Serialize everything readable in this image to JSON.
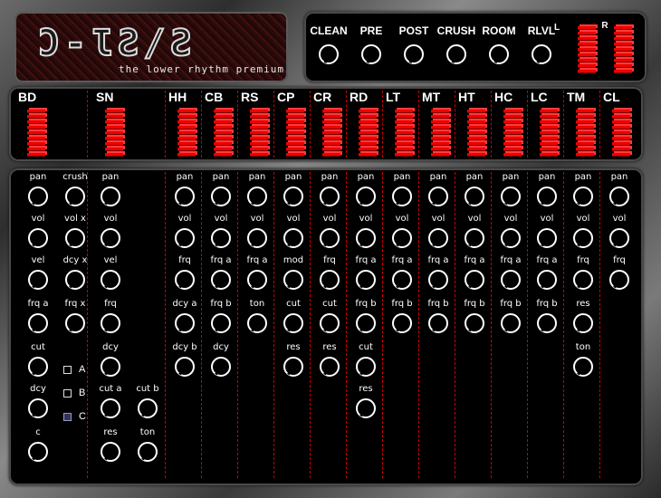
{
  "logo": {
    "title": "Ɔ-ƖƧ/Ƨ",
    "subtitle": "the lower rhythm premium"
  },
  "fx": {
    "knobs": [
      "CLEAN",
      "PRE",
      "POST",
      "CRUSH",
      "ROOM",
      "RLVL"
    ],
    "meter_left_label": "L",
    "meter_right_label": "R"
  },
  "channels": [
    "BD",
    "SN",
    "HH",
    "CB",
    "RS",
    "CP",
    "CR",
    "RD",
    "LT",
    "MT",
    "HT",
    "HC",
    "LC",
    "TM",
    "CL"
  ],
  "bd": {
    "col1": [
      "pan",
      "vol",
      "vel",
      "frq a",
      "cut",
      "dcy",
      "c"
    ],
    "col2": [
      "crush",
      "vol x",
      "dcy x",
      "frq x"
    ],
    "mode_options": [
      "A",
      "B",
      "C"
    ],
    "mode_selected": "C"
  },
  "sn": {
    "col": [
      "pan",
      "vol",
      "vel",
      "frq",
      "dcy",
      "cut a",
      "res"
    ],
    "col2": [
      "cut b",
      "ton"
    ]
  },
  "channel_params": {
    "HH": [
      "pan",
      "vol",
      "frq",
      "dcy a",
      "dcy b"
    ],
    "CB": [
      "pan",
      "vol",
      "frq a",
      "frq b",
      "dcy"
    ],
    "RS": [
      "pan",
      "vol",
      "frq a",
      "ton"
    ],
    "CP": [
      "pan",
      "vol",
      "mod",
      "cut",
      "res"
    ],
    "CR": [
      "pan",
      "vol",
      "frq",
      "cut",
      "res"
    ],
    "RD": [
      "pan",
      "vol",
      "frq a",
      "frq b",
      "cut",
      "res"
    ],
    "LT": [
      "pan",
      "vol",
      "frq a",
      "frq b"
    ],
    "MT": [
      "pan",
      "vol",
      "frq a",
      "frq b"
    ],
    "HT": [
      "pan",
      "vol",
      "frq a",
      "frq b"
    ],
    "HC": [
      "pan",
      "vol",
      "frq a",
      "frq b"
    ],
    "LC": [
      "pan",
      "vol",
      "frq a",
      "frq b"
    ],
    "TM": [
      "pan",
      "vol",
      "frq",
      "res",
      "ton"
    ],
    "CL": [
      "pan",
      "vol",
      "frq"
    ]
  },
  "colors": {
    "accent": "#e00000",
    "panel": "#000000",
    "text": "#ffffff"
  }
}
